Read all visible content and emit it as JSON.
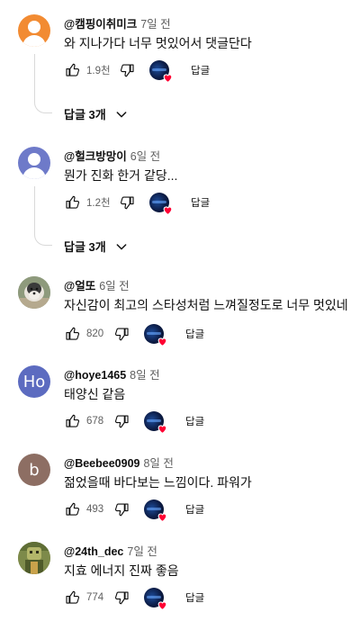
{
  "comments": [
    {
      "handle": "@캠핑이취미크",
      "time": "7일 전",
      "text": "와 지나가다 너무 멋있어서 댓글단다",
      "likes": "1.9천",
      "reply_label": "답글",
      "replies_label": "답글 3개",
      "avatar": {
        "type": "person",
        "color": "#f28b32"
      }
    },
    {
      "handle": "@헐크방망이",
      "time": "6일 전",
      "text": "뭔가 진화 한거 같당...",
      "likes": "1.2천",
      "reply_label": "답글",
      "replies_label": "답글 3개",
      "avatar": {
        "type": "person",
        "color": "#6e7ac9"
      }
    },
    {
      "handle": "@얼또",
      "time": "6일 전",
      "text": "자신감이 최고의 스타성처럼 느껴질정도로 너무 멋있네",
      "likes": "820",
      "reply_label": "답글",
      "avatar": {
        "type": "photo-dog"
      }
    },
    {
      "handle": "@hoye1465",
      "time": "8일 전",
      "text": "태양신 같음",
      "likes": "678",
      "reply_label": "답글",
      "avatar": {
        "type": "letter",
        "letter": "Ho",
        "color": "#5c6bc0"
      }
    },
    {
      "handle": "@Beebee0909",
      "time": "8일 전",
      "text": "젊었을때 바다보는 느낌이다. 파워가",
      "likes": "493",
      "reply_label": "답글",
      "avatar": {
        "type": "letter",
        "letter": "b",
        "color": "#8d6e63"
      }
    },
    {
      "handle": "@24th_dec",
      "time": "7일 전",
      "text": "지효 에너지 진짜 좋음",
      "likes": "774",
      "reply_label": "답글",
      "avatar": {
        "type": "photo-char"
      }
    }
  ],
  "colors": {
    "heart": "#ff0033",
    "secondary_text": "#606060",
    "thread_line": "#d9d9d9"
  },
  "icons": [
    "thumb-up-icon",
    "thumb-down-icon",
    "creator-heart-icon",
    "chevron-down-icon"
  ]
}
